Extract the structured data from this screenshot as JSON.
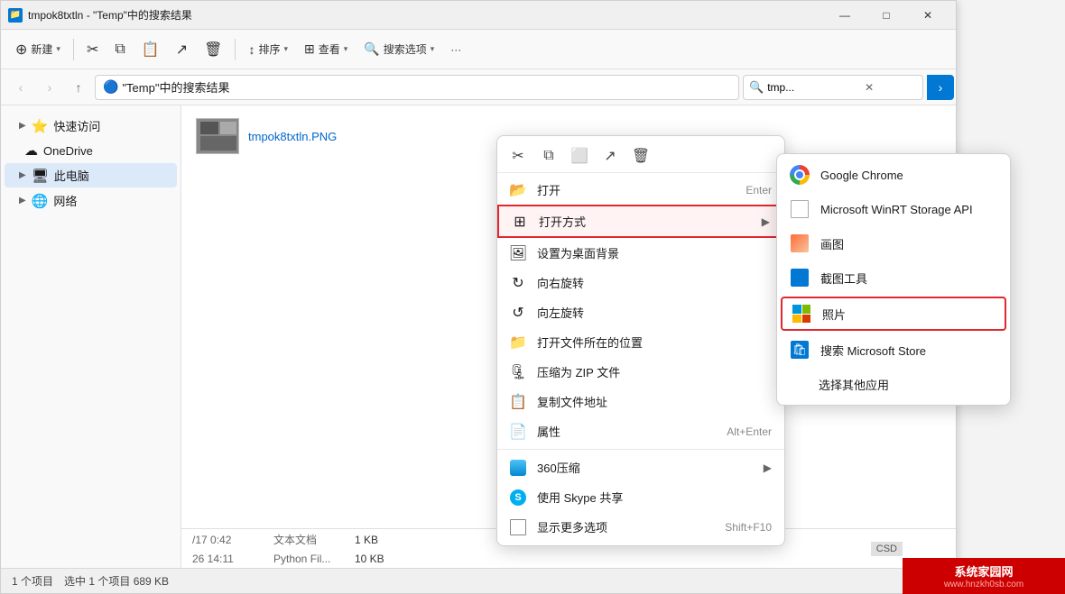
{
  "window": {
    "title": "tmpok8txtln - \"Temp\"中的搜索结果",
    "controls": {
      "minimize": "—",
      "maximize": "□",
      "close": "✕"
    }
  },
  "toolbar": {
    "new_label": "新建",
    "cut_label": "剪切",
    "sort_label": "排序",
    "view_label": "查看",
    "search_options_label": "搜索选项",
    "more_label": "···"
  },
  "address_bar": {
    "path": "\"Temp\"中的搜索结果",
    "search_placeholder": "tmp...",
    "nav": {
      "back": "‹",
      "forward": "›",
      "up": "↑"
    }
  },
  "sidebar": {
    "items": [
      {
        "id": "quick-access",
        "label": "快速访问",
        "icon": "⭐",
        "expanded": false
      },
      {
        "id": "onedrive",
        "label": "OneDrive",
        "icon": "☁",
        "expanded": false
      },
      {
        "id": "this-pc",
        "label": "此电脑",
        "icon": "🖥",
        "expanded": false,
        "selected": true
      },
      {
        "id": "network",
        "label": "网络",
        "icon": "🌐",
        "expanded": false
      }
    ]
  },
  "file": {
    "thumbnail_alt": "image thumbnail",
    "name_prefix": "tmpok8txtln",
    "name_ext": ".PNG"
  },
  "status_bar": {
    "count": "1 个项目",
    "selected": "选中 1 个项目 689 KB"
  },
  "context_menu": {
    "toolbar_icons": [
      "✂",
      "📱",
      "⬜",
      "↗",
      "🗑"
    ],
    "items": [
      {
        "id": "open",
        "icon": "📂",
        "label": "打开",
        "shortcut": "Enter",
        "has_arrow": false
      },
      {
        "id": "open-with",
        "icon": "⊞",
        "label": "打开方式",
        "shortcut": "",
        "has_arrow": true,
        "highlighted": true
      },
      {
        "id": "set-wallpaper",
        "icon": "🖼",
        "label": "设置为桌面背景",
        "shortcut": "",
        "has_arrow": false
      },
      {
        "id": "rotate-right",
        "icon": "↻",
        "label": "向右旋转",
        "shortcut": "",
        "has_arrow": false
      },
      {
        "id": "rotate-left",
        "icon": "↺",
        "label": "向左旋转",
        "shortcut": "",
        "has_arrow": false
      },
      {
        "id": "open-location",
        "icon": "📁",
        "label": "打开文件所在的位置",
        "shortcut": "",
        "has_arrow": false
      },
      {
        "id": "compress-zip",
        "icon": "🗜",
        "label": "压缩为 ZIP 文件",
        "shortcut": "",
        "has_arrow": false
      },
      {
        "id": "copy-path",
        "icon": "📋",
        "label": "复制文件地址",
        "shortcut": "",
        "has_arrow": false
      },
      {
        "id": "properties",
        "icon": "📄",
        "label": "属性",
        "shortcut": "Alt+Enter",
        "has_arrow": false
      },
      {
        "id": "360compress",
        "icon": "📦",
        "label": "360压缩",
        "shortcut": "",
        "has_arrow": true
      },
      {
        "id": "skype-share",
        "icon": "S",
        "label": "使用 Skype 共享",
        "shortcut": "",
        "has_arrow": false
      },
      {
        "id": "more-options",
        "icon": "⊡",
        "label": "显示更多选项",
        "shortcut": "Shift+F10",
        "has_arrow": false
      }
    ]
  },
  "submenu": {
    "items": [
      {
        "id": "chrome",
        "label": "Google Chrome"
      },
      {
        "id": "msrt",
        "label": "Microsoft WinRT Storage API"
      },
      {
        "id": "paint",
        "label": "画图"
      },
      {
        "id": "snip",
        "label": "截图工具"
      },
      {
        "id": "photos",
        "label": "照片",
        "highlighted": true
      },
      {
        "id": "store",
        "label": "搜索 Microsoft Store"
      },
      {
        "id": "choose-app",
        "label": "选择其他应用"
      }
    ]
  },
  "bottom_rows": [
    {
      "date": "/17 0:42",
      "type": "文本文档",
      "size": "1 KB"
    },
    {
      "date": "26 14:11",
      "type": "Python Fil...",
      "size": "10 KB"
    }
  ],
  "watermark": {
    "text": "系统家园网",
    "url": "www.hnzkh0sb.com"
  }
}
